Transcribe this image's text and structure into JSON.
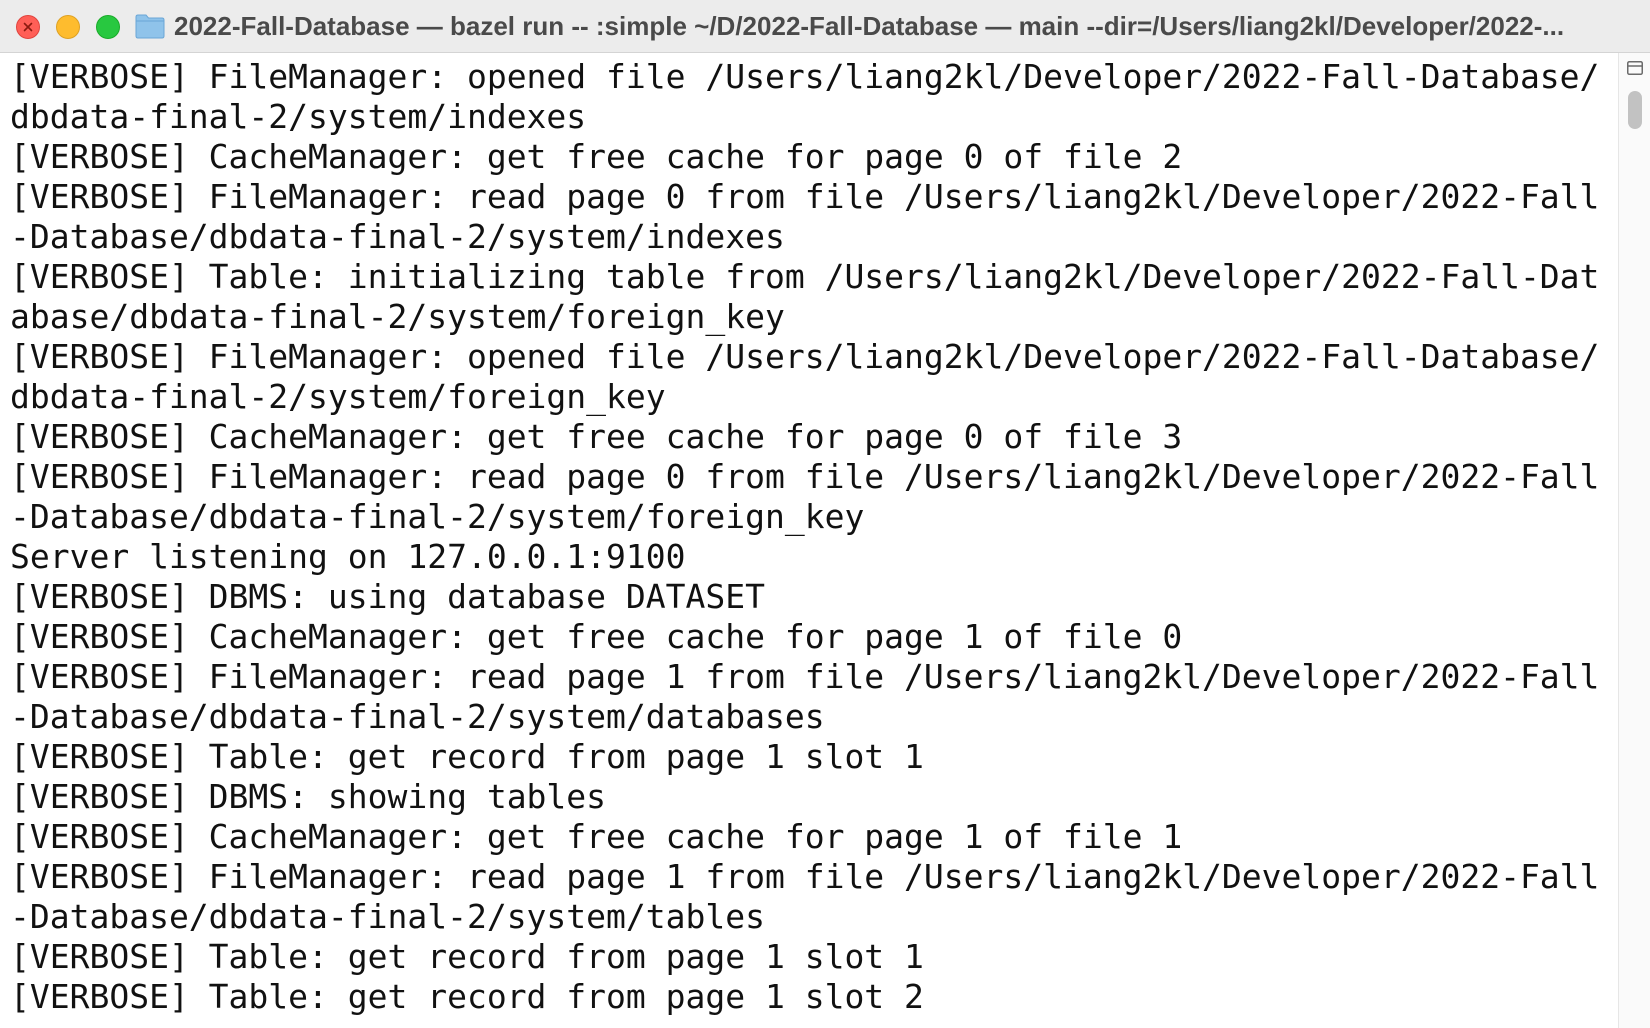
{
  "window": {
    "title": "2022-Fall-Database — bazel run -- :simple ~/D/2022-Fall-Database — main --dir=/Users/liang2kl/Developer/2022-..."
  },
  "traffic_lights": {
    "close_color": "#ff5f57",
    "minimize_color": "#febc2e",
    "zoom_color": "#28c840"
  },
  "icons": {
    "folder": "folder-icon",
    "split": "split-pane-icon"
  },
  "terminal": {
    "lines": [
      "[VERBOSE] FileManager: opened file /Users/liang2kl/Developer/2022-Fall-Database/",
      "dbdata-final-2/system/indexes",
      "[VERBOSE] CacheManager: get free cache for page 0 of file 2",
      "[VERBOSE] FileManager: read page 0 from file /Users/liang2kl/Developer/2022-Fall",
      "-Database/dbdata-final-2/system/indexes",
      "[VERBOSE] Table: initializing table from /Users/liang2kl/Developer/2022-Fall-Dat",
      "abase/dbdata-final-2/system/foreign_key",
      "[VERBOSE] FileManager: opened file /Users/liang2kl/Developer/2022-Fall-Database/",
      "dbdata-final-2/system/foreign_key",
      "[VERBOSE] CacheManager: get free cache for page 0 of file 3",
      "[VERBOSE] FileManager: read page 0 from file /Users/liang2kl/Developer/2022-Fall",
      "-Database/dbdata-final-2/system/foreign_key",
      "Server listening on 127.0.0.1:9100",
      "[VERBOSE] DBMS: using database DATASET",
      "[VERBOSE] CacheManager: get free cache for page 1 of file 0",
      "[VERBOSE] FileManager: read page 1 from file /Users/liang2kl/Developer/2022-Fall",
      "-Database/dbdata-final-2/system/databases",
      "[VERBOSE] Table: get record from page 1 slot 1",
      "[VERBOSE] DBMS: showing tables",
      "[VERBOSE] CacheManager: get free cache for page 1 of file 1",
      "[VERBOSE] FileManager: read page 1 from file /Users/liang2kl/Developer/2022-Fall",
      "-Database/dbdata-final-2/system/tables",
      "[VERBOSE] Table: get record from page 1 slot 1",
      "[VERBOSE] Table: get record from page 1 slot 2"
    ]
  }
}
